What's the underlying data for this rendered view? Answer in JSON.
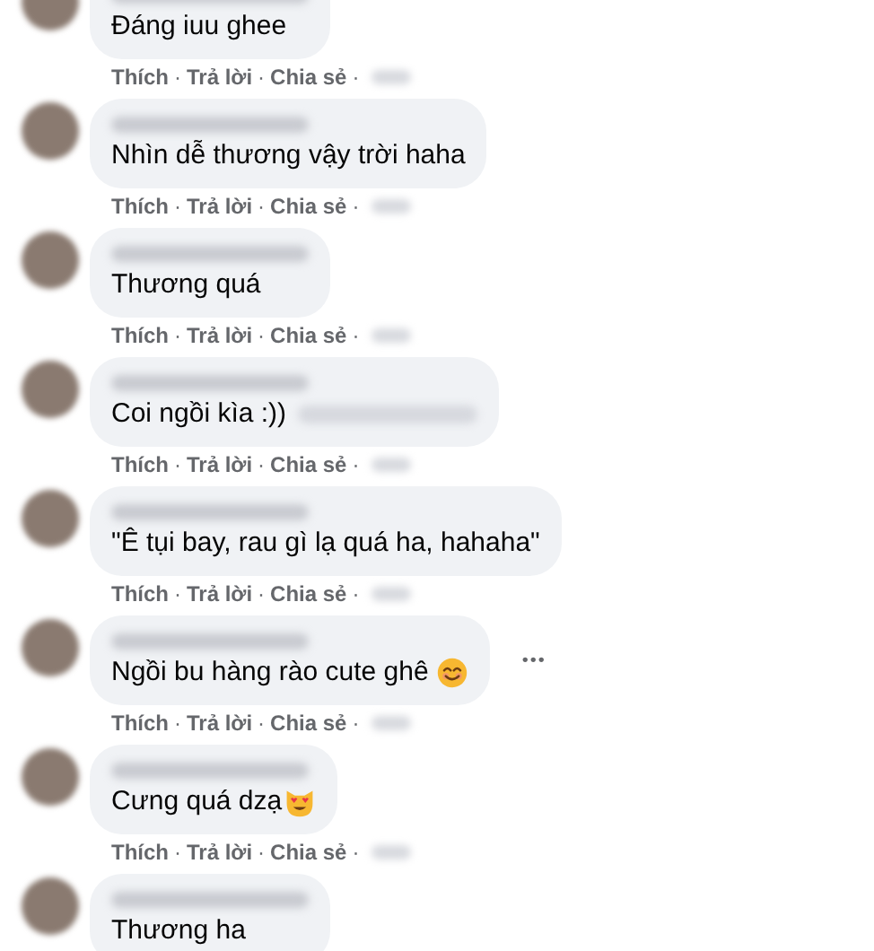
{
  "comments": [
    {
      "kind": "plain",
      "text": "Đáng iuu ghee",
      "actions": [
        "Thích",
        "Trả lời",
        "Chia sẻ"
      ],
      "separator": "·"
    },
    {
      "kind": "plain",
      "text": "Nhìn dễ thương vậy trời haha",
      "actions": [
        "Thích",
        "Trả lời",
        "Chia sẻ"
      ],
      "separator": "·"
    },
    {
      "kind": "plain",
      "text": "Thương quá",
      "actions": [
        "Thích",
        "Trả lời",
        "Chia sẻ"
      ],
      "separator": "·"
    },
    {
      "kind": "plain",
      "text": "Coi ngồi kìa :))",
      "mention": true,
      "actions": [
        "Thích",
        "Trả lời",
        "Chia sẻ"
      ],
      "separator": "·"
    },
    {
      "kind": "plain",
      "text": "\"Ê tụi bay, rau gì lạ quá ha, hahaha\"",
      "actions": [
        "Thích",
        "Trả lời",
        "Chia sẻ"
      ],
      "separator": "·"
    },
    {
      "kind": "smile",
      "text": "Ngồi bu hàng rào cute ghê",
      "more_menu": true,
      "actions": [
        "Thích",
        "Trả lời",
        "Chia sẻ"
      ],
      "separator": "·"
    },
    {
      "kind": "cat",
      "text": "Cưng quá dzạ",
      "actions": [
        "Thích",
        "Trả lời",
        "Chia sẻ"
      ],
      "separator": "·"
    },
    {
      "kind": "plain",
      "text": "Thương ha"
    }
  ],
  "more_menu_label": "•••"
}
